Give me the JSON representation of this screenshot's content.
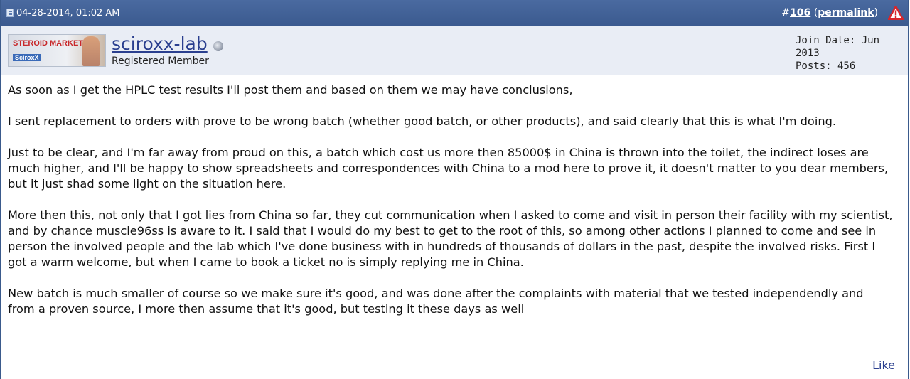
{
  "header": {
    "date": "04-28-2014, 01:02 AM",
    "post_number_prefix": "#",
    "post_number": "106",
    "permalink_label": "permalink",
    "paren_open": " (",
    "paren_close": ")"
  },
  "user": {
    "avatar_text_top": "STEROID MARKET",
    "avatar_text_bottom": "SciroxX",
    "username": "sciroxx-lab",
    "title": "Registered Member",
    "join_date": "Join Date: Jun 2013",
    "posts": "Posts: 456"
  },
  "body": {
    "paragraphs": [
      "As soon as I get the HPLC test results I'll post them and based on them we may have conclusions,",
      "I sent replacement to orders with prove to be wrong batch (whether good batch, or other products), and said clearly that this is what I'm doing.",
      "Just to be clear, and I'm far away from proud on this, a batch which cost us more then 85000$ in China is thrown into the toilet, the indirect loses are much higher, and I'll be happy to show spreadsheets and correspondences with China to a mod here to prove it, it doesn't matter to you dear members, but it just shad some light on the situation here.",
      "More then this, not only that I got lies from China so far, they cut communication when I asked to come and visit in person their facility with my scientist, and by chance muscle96ss is aware to it. I said that I would do my best to get to the root of this, so among other actions I planned to come and see in person the involved people and the lab which I've done business with in hundreds of thousands of dollars in the past, despite the involved risks. First I got a warm welcome, but when I came to book a ticket no is simply replying me in China.",
      "New batch is much smaller of course so we make sure it's good, and was done after the complaints with material that we tested independendly and from a proven source, I more then assume that it's good, but testing it these days as well"
    ]
  },
  "footer": {
    "like_label": "Like"
  },
  "icons": {
    "post_icon": "document-icon",
    "report_icon": "warning-triangle-icon",
    "status_icon": "offline-status-icon"
  },
  "colors": {
    "header_bg": "#3b5a8f",
    "userbar_bg": "#e9edf5",
    "link": "#2a3f8f",
    "warning": "#d7262b"
  }
}
